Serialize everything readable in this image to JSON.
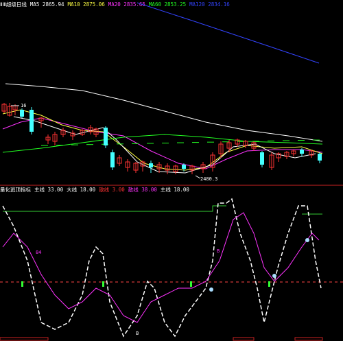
{
  "colors": {
    "bg": "#000000",
    "ma_white": "#ffffff",
    "ma_yellow": "#ffff44",
    "ma_magenta": "#ff33ff",
    "ma_green": "#22ff22",
    "ma_blue": "#3344ff",
    "candle_up": "#ff3333",
    "candle_down": "#44ffff",
    "divider": "#cc2222",
    "ind_white": "#ffffff",
    "ind_magenta": "#ff33ff",
    "ind_green_line": "#33cc33",
    "ind_dashed": "#ff4444"
  },
  "top_header": [
    {
      "text": "ⅡⅢ超级日线",
      "color": "#ffffff"
    },
    {
      "text": "MA5 2865.94",
      "color": "#ffffff"
    },
    {
      "text": "MA10 2875.06",
      "color": "#ffff44"
    },
    {
      "text": "MA20 2835.65",
      "color": "#ff33ff"
    },
    {
      "text": "MA60 2853.25",
      "color": "#22ff22"
    },
    {
      "text": "MA120 2834.16",
      "color": "#3344ff"
    }
  ],
  "indicator_header": [
    {
      "text": "量化逃顶指标",
      "color": "#ffffff"
    },
    {
      "text": "主线 33.00",
      "color": "#ffffff"
    },
    {
      "text": "大线 18.00",
      "color": "#ffffff"
    },
    {
      "text": "散线 3.00",
      "color": "#ff3333"
    },
    {
      "text": "散线 38.00",
      "color": "#ff33ff"
    },
    {
      "text": "主线 18.00",
      "color": "#ffffff"
    }
  ],
  "price_labels": {
    "high_marker": "16",
    "low_marker": "2480.3"
  },
  "indicator_markers": [
    {
      "text": "84",
      "color": "#ff33ff"
    },
    {
      "text": "B",
      "color": "#ff33ff"
    },
    {
      "text": "B",
      "color": "#ffffff"
    }
  ]
}
